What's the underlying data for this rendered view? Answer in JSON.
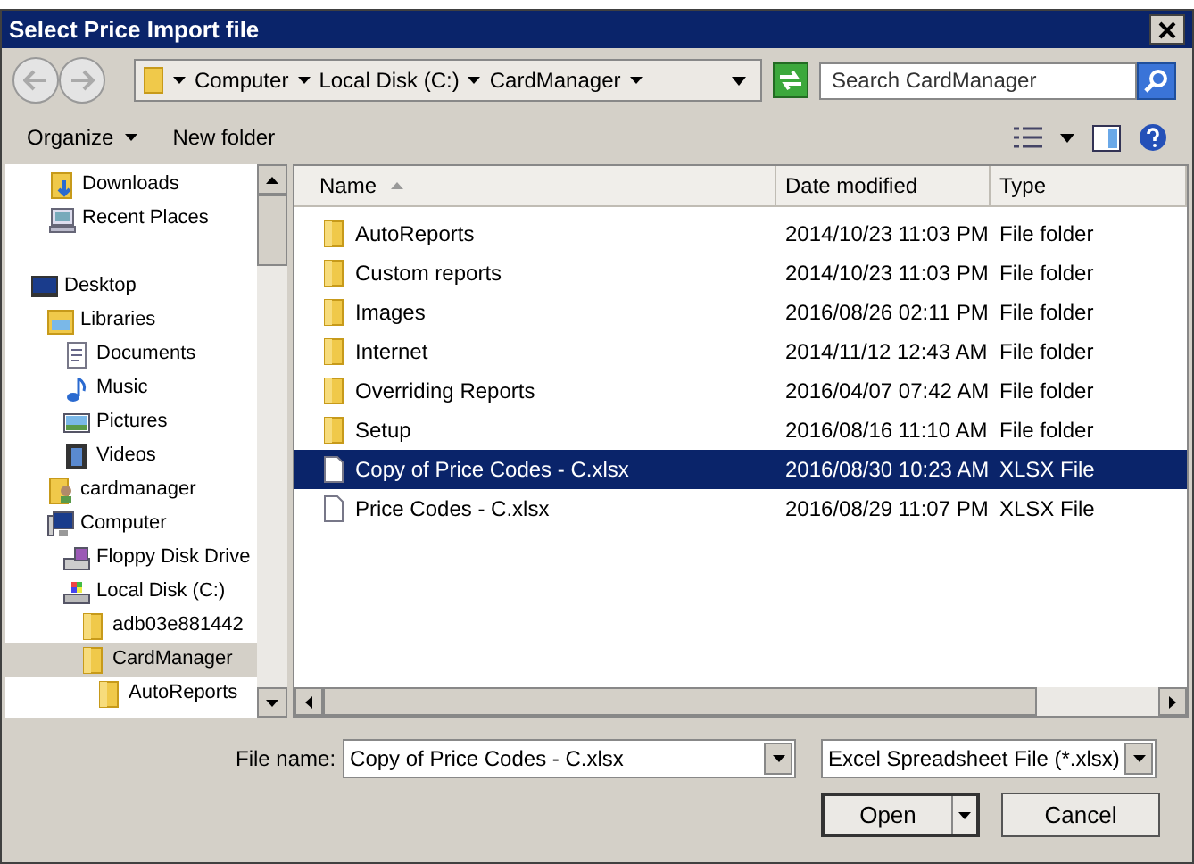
{
  "window": {
    "title": "Select Price Import file"
  },
  "breadcrumb": [
    "Computer",
    "Local Disk (C:)",
    "CardManager"
  ],
  "search": {
    "placeholder": "Search CardManager"
  },
  "toolbar": {
    "organize": "Organize",
    "new_folder": "New folder"
  },
  "sidebar": {
    "favorites": [
      {
        "label": "Downloads",
        "kind": "downloads",
        "selected": false
      },
      {
        "label": "Recent Places",
        "kind": "recent",
        "selected": false
      }
    ],
    "tree": [
      {
        "label": "Desktop",
        "kind": "desktop",
        "selected": false,
        "children": [
          {
            "label": "Libraries",
            "kind": "libraries",
            "selected": false,
            "children": [
              {
                "label": "Documents",
                "kind": "documents",
                "selected": false
              },
              {
                "label": "Music",
                "kind": "music",
                "selected": false
              },
              {
                "label": "Pictures",
                "kind": "pictures",
                "selected": false
              },
              {
                "label": "Videos",
                "kind": "videos",
                "selected": false
              }
            ]
          },
          {
            "label": "cardmanager",
            "kind": "user",
            "selected": false
          },
          {
            "label": "Computer",
            "kind": "computer",
            "selected": false,
            "children": [
              {
                "label": "Floppy Disk Drive",
                "kind": "floppy",
                "selected": false
              },
              {
                "label": "Local Disk (C:)",
                "kind": "disk",
                "selected": false,
                "children": [
                  {
                    "label": "adb03e881442",
                    "kind": "folder",
                    "selected": false
                  },
                  {
                    "label": "CardManager",
                    "kind": "folder",
                    "selected": true,
                    "children": [
                      {
                        "label": "AutoReports",
                        "kind": "folder",
                        "selected": false
                      }
                    ]
                  }
                ]
              }
            ]
          }
        ]
      }
    ]
  },
  "table": {
    "columns": [
      "Name",
      "Date modified",
      "Type"
    ],
    "rows": [
      {
        "kind": "folder",
        "name": "AutoReports",
        "date": "2014/10/23 11:03 PM",
        "type": "File folder",
        "selected": false
      },
      {
        "kind": "folder",
        "name": "Custom reports",
        "date": "2014/10/23 11:03 PM",
        "type": "File folder",
        "selected": false
      },
      {
        "kind": "folder",
        "name": "Images",
        "date": "2016/08/26 02:11 PM",
        "type": "File folder",
        "selected": false
      },
      {
        "kind": "folder",
        "name": "Internet",
        "date": "2014/11/12 12:43 AM",
        "type": "File folder",
        "selected": false
      },
      {
        "kind": "folder",
        "name": "Overriding Reports",
        "date": "2016/04/07 07:42 AM",
        "type": "File folder",
        "selected": false
      },
      {
        "kind": "folder",
        "name": "Setup",
        "date": "2016/08/16 11:10 AM",
        "type": "File folder",
        "selected": false
      },
      {
        "kind": "file",
        "name": "Copy of Price Codes - C.xlsx",
        "date": "2016/08/30 10:23 AM",
        "type": "XLSX File",
        "selected": true
      },
      {
        "kind": "file",
        "name": "Price Codes - C.xlsx",
        "date": "2016/08/29 11:07 PM",
        "type": "XLSX File",
        "selected": false
      }
    ]
  },
  "footer": {
    "file_name_label": "File name:",
    "file_name": "Copy of Price Codes - C.xlsx",
    "file_type": "Excel Spreadsheet File (*.xlsx)",
    "open": "Open",
    "cancel": "Cancel"
  }
}
